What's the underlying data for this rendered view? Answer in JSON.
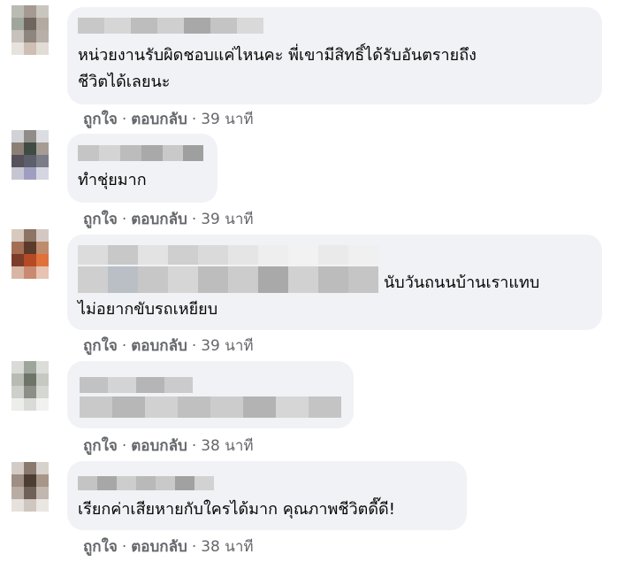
{
  "comments": [
    {
      "text": "หน่วยงานรับผิดชอบแค่ไหนคะ พี่เขามีสิทธิ์ได้รับอันตรายถึง\nชีวิตได้เลยนะ",
      "like": "ถูกใจ",
      "sep": "·",
      "reply": "ตอบกลับ",
      "time": "39 นาที"
    },
    {
      "text": "ทำชุ่ยมาก",
      "like": "ถูกใจ",
      "sep": "·",
      "reply": "ตอบกลับ",
      "time": "39 นาที"
    },
    {
      "text_tail": "นับวันถนนบ้านเราแทบ",
      "text": "ไม่อยากขับรถเหยียบ",
      "like": "ถูกใจ",
      "sep": "·",
      "reply": "ตอบกลับ",
      "time": "39 นาที"
    },
    {
      "like": "ถูกใจ",
      "sep": "·",
      "reply": "ตอบกลับ",
      "time": "38 นาที"
    },
    {
      "text": "เรียกค่าเสียหายกับใครได้มาก คุณภาพชีวิตดี๊ดี!",
      "like": "ถูกใจ",
      "sep": "·",
      "reply": "ตอบกลับ",
      "time": "38 นาที"
    }
  ]
}
